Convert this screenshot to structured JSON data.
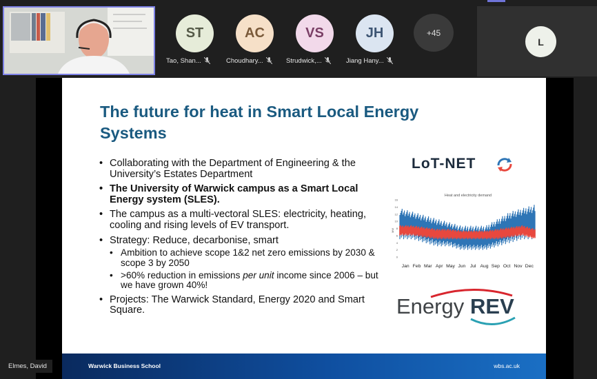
{
  "participants": [
    {
      "initials": "ST",
      "name": "Tao, Shan...",
      "color": "#e6ecd9"
    },
    {
      "initials": "AC",
      "name": "Choudhary...",
      "color": "#f6e0c8"
    },
    {
      "initials": "VS",
      "name": "Strudwick,...",
      "color": "#f2d9ea"
    },
    {
      "initials": "JH",
      "name": "Jiang Hany...",
      "color": "#dbe5f1"
    }
  ],
  "more_count": "+45",
  "extra_participant": {
    "initials": "L"
  },
  "speaker_name": "Elmes, David",
  "slide": {
    "title_line1": "The future for heat in Smart Local Energy",
    "title_line2": "Systems",
    "bullets": {
      "b1": "Collaborating with the Department of Engineering & the University’s Estates Department",
      "b2": "The University of Warwick campus as a Smart Local Energy system (SLES).",
      "b3": "The campus as a multi-vectoral SLES: electricity, heating, cooling and rising levels of EV transport.",
      "b4": "Strategy: Reduce, decarbonise, smart",
      "b4_sub1": "Ambition to achieve scope 1&2 net zero emissions by 2030 & scope 3 by 2050",
      "b4_sub2_a": ">60% reduction in emissions ",
      "b4_sub2_em": "per unit",
      "b4_sub2_b": " income since 2006 – but we have grown 40%!",
      "b5": "Projects: The Warwick Standard, Energy 2020 and Smart Square."
    },
    "lotnet_logo": "LoT-NET",
    "energyrev_logo_a": "Energy",
    "energyrev_logo_b": "REV",
    "footer_left": "Warwick Business School",
    "footer_right": "wbs.ac.uk"
  },
  "chart_data": {
    "type": "line",
    "title": "Heat and electricity demand",
    "ylabel": "MW",
    "ylim": [
      0,
      16
    ],
    "yticks": [
      "16",
      "14",
      "12",
      "10",
      "8",
      "6",
      "4",
      "2",
      "0"
    ],
    "categories": [
      "Jan",
      "Feb",
      "Mar",
      "Apr",
      "May",
      "Jun",
      "Jul",
      "Aug",
      "Sep",
      "Oct",
      "Nov",
      "Dec"
    ],
    "series": [
      {
        "color": "#2e75b6",
        "low": [
          5,
          5,
          4,
          3,
          3,
          2,
          2,
          2,
          3,
          4,
          5,
          5
        ],
        "high": [
          14,
          13,
          12,
          11,
          10,
          9,
          9,
          9,
          11,
          13,
          14,
          15
        ]
      },
      {
        "color": "#e8483e",
        "low": [
          6,
          6,
          5.5,
          5,
          5,
          5,
          5,
          5,
          5,
          5.5,
          6,
          5
        ],
        "high": [
          9,
          9,
          8.5,
          8,
          8,
          7.5,
          7.5,
          7.5,
          8,
          8.5,
          9,
          8
        ]
      }
    ]
  }
}
